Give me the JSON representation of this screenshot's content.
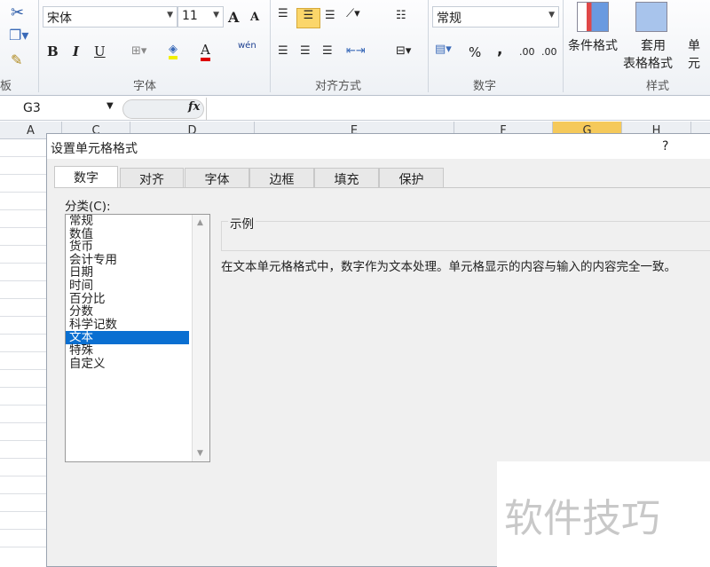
{
  "ribbon": {
    "font_name": "宋体",
    "font_size": "11",
    "number_format": "常规",
    "groups": {
      "clipboard": "板",
      "font": "字体",
      "alignment": "对齐方式",
      "number": "数字",
      "styles": "样式"
    },
    "buttons": {
      "bold": "B",
      "italic": "I",
      "underline": "U",
      "grow": "A",
      "shrink": "A",
      "font_color": "A",
      "phonetic": "wén",
      "percent": "%",
      "comma": ",",
      "inc_dec": ".00",
      "cond_format": "条件格式",
      "table_format_1": "套用",
      "table_format_2": "表格格式",
      "cell_styles": "单元"
    }
  },
  "formula_bar": {
    "name_box": "G3",
    "fx": "fx",
    "value": ""
  },
  "columns": [
    "A",
    "C",
    "D",
    "E",
    "F",
    "G",
    "H"
  ],
  "dialog": {
    "title": "设置单元格格式",
    "help": "?",
    "tabs": [
      "数字",
      "对齐",
      "字体",
      "边框",
      "填充",
      "保护"
    ],
    "category_label": "分类(C):",
    "categories": [
      "常规",
      "数值",
      "货币",
      "会计专用",
      "日期",
      "时间",
      "百分比",
      "分数",
      "科学记数",
      "文本",
      "特殊",
      "自定义"
    ],
    "selected": "文本",
    "sample_label": "示例",
    "description": "在文本单元格格式中，数字作为文本处理。单元格显示的内容与输入的内容完全一致。"
  },
  "watermark": "软件技巧"
}
